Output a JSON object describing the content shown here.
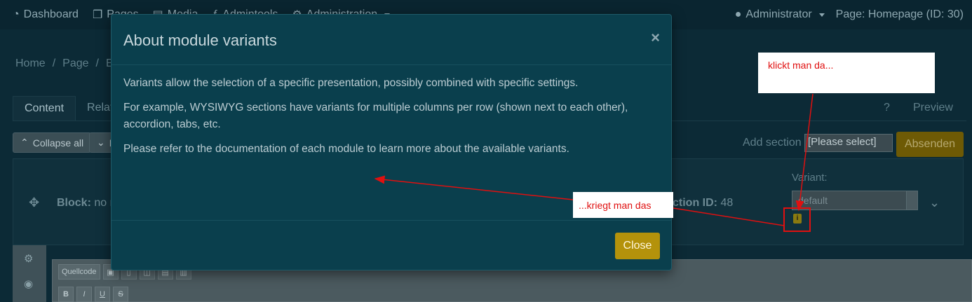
{
  "topnav": {
    "items": [
      "Dashboard",
      "Pages",
      "Media",
      "Admintools",
      "Administration"
    ],
    "user": "Administrator",
    "page_info": "Page: Homepage (ID: 30)"
  },
  "breadcrumb": [
    "Home",
    "/",
    "Page",
    "/",
    "Ed"
  ],
  "tabs": {
    "content": "Content",
    "related": "Relat",
    "help": "?",
    "preview": "Preview"
  },
  "toolbar": {
    "collapse_all": "Collapse all",
    "expand": "E",
    "add_section_label": "Add section",
    "add_section_value": "[Please select]",
    "submit": "Absenden"
  },
  "block": {
    "label_bold": "Block:",
    "label_rest": "no n",
    "section_id_text": "ction ID:",
    "section_id_value": "48",
    "variant_label": "Variant:",
    "variant_value": "default"
  },
  "editor": {
    "source_label": "Quellcode"
  },
  "modal": {
    "title": "About module variants",
    "close_x": "×",
    "paragraphs": [
      "Variants allow the selection of a specific presentation, possibly combined with specific settings.",
      "For example, WYSIWYG sections have variants for multiple columns per row (shown next to each other), accordion, tabs, etc.",
      "Please refer to the documentation of each module to learn more about the available variants."
    ],
    "close_button": "Close"
  },
  "annotations": {
    "note_top": "klickt man da...",
    "note_bottom": "...kriegt man das",
    "color": "#e01010"
  }
}
